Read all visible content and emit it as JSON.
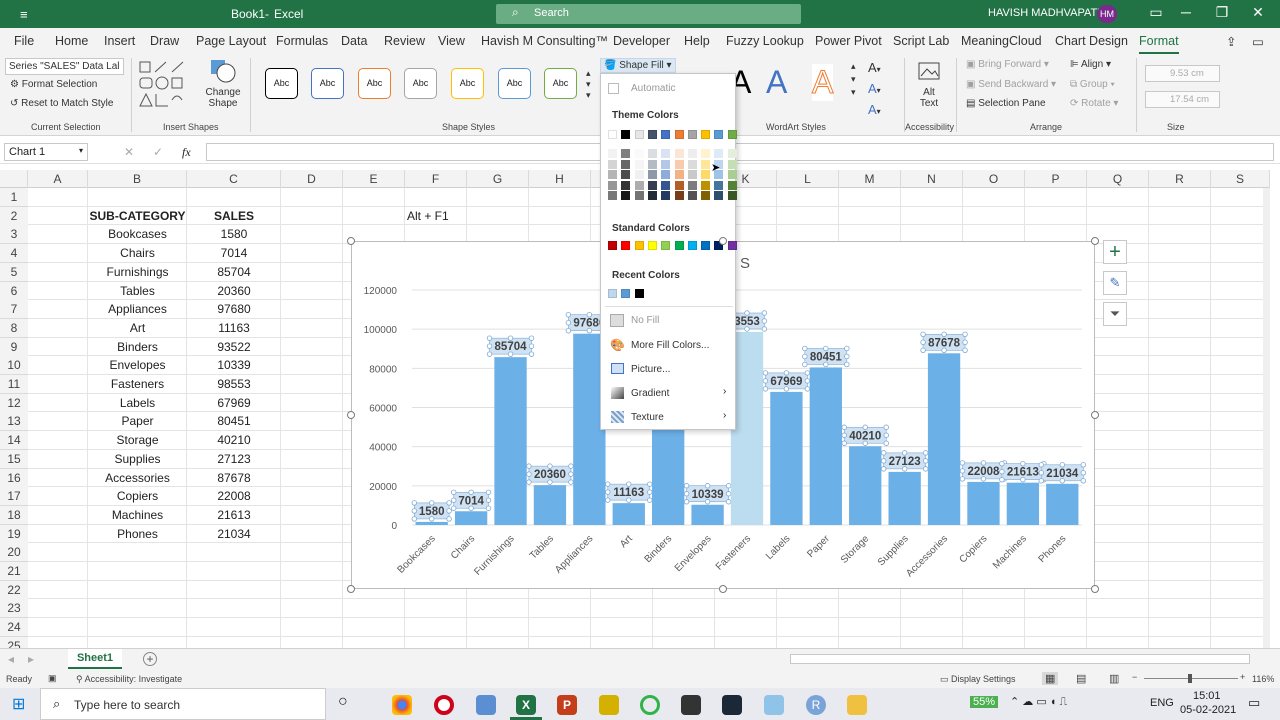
{
  "titlebar": {
    "autosave_icon": "≡",
    "filename": "Book1",
    "sep": "-",
    "app": "Excel",
    "search_placeholder": "Search",
    "user": "HAVISH MADHVAPATY",
    "initials": "HM"
  },
  "tabs": [
    "File",
    "Home",
    "Insert",
    "Draw",
    "Page Layout",
    "Formulas",
    "Data",
    "Review",
    "View",
    "Havish M Consulting™",
    "Developer",
    "Help",
    "Fuzzy Lookup",
    "Power Pivot",
    "Script Lab",
    "MeaningCloud",
    "Chart Design",
    "Format"
  ],
  "ribbon": {
    "selection_dropdown": "Series \"SALES\" Data Lal",
    "format_selection": "Format Selection",
    "reset_style": "Reset to Match Style",
    "current_selection": "Current Selection",
    "change_shape": "Change Shape",
    "insert_shapes": "Insert Shapes",
    "abc": "Abc",
    "shape_styles": "Shape Styles",
    "shape_fill": "Shape Fill",
    "wordart_styles": "WordArt Styles",
    "alt_text": "Alt Text",
    "accessibility": "Accessibility",
    "bring_forward": "Bring Forward",
    "send_backward": "Send Backward",
    "selection_pane": "Selection Pane",
    "align": "Align",
    "group": "Group",
    "rotate": "Rotate",
    "arrange": "Arrange",
    "height": "9.53 cm",
    "width": "17.54 cm",
    "size": "Size"
  },
  "formula_bar": {
    "name_box": "Chart 1",
    "fx": "fx",
    "cancel": "✕",
    "enter": "✓"
  },
  "columns": [
    "A",
    "B",
    "C",
    "D",
    "E",
    "F",
    "G",
    "H",
    "I",
    "J",
    "K",
    "L",
    "M",
    "N",
    "O",
    "P",
    "Q",
    "R",
    "S"
  ],
  "rows": [
    "1",
    "2",
    "3",
    "4",
    "5",
    "6",
    "7",
    "8",
    "9",
    "10",
    "11",
    "12",
    "13",
    "14",
    "15",
    "16",
    "17",
    "18",
    "19",
    "20",
    "21",
    "22",
    "23",
    "24",
    "25"
  ],
  "table": {
    "header_category": "SUB-CATEGORY",
    "header_sales": "SALES",
    "rows": [
      [
        "Bookcases",
        "1580"
      ],
      [
        "Chairs",
        "7014"
      ],
      [
        "Furnishings",
        "85704"
      ],
      [
        "Tables",
        "20360"
      ],
      [
        "Appliances",
        "97680"
      ],
      [
        "Art",
        "11163"
      ],
      [
        "Binders",
        "93522"
      ],
      [
        "Envelopes",
        "10339"
      ],
      [
        "Fasteners",
        "98553"
      ],
      [
        "Labels",
        "67969"
      ],
      [
        "Paper",
        "80451"
      ],
      [
        "Storage",
        "40210"
      ],
      [
        "Supplies",
        "27123"
      ],
      [
        "Accessories",
        "87678"
      ],
      [
        "Copiers",
        "22008"
      ],
      [
        "Machines",
        "21613"
      ],
      [
        "Phones",
        "21034"
      ]
    ]
  },
  "note": "Alt + F1",
  "chart_data": {
    "type": "bar",
    "title": "S",
    "categories": [
      "Bookcases",
      "Chairs",
      "Furnishings",
      "Tables",
      "Appliances",
      "Art",
      "Binders",
      "Envelopes",
      "Fasteners",
      "Labels",
      "Paper",
      "Storage",
      "Supplies",
      "Accessories",
      "Copiers",
      "Machines",
      "Phones"
    ],
    "values": [
      1580,
      7014,
      85704,
      20360,
      97680,
      11163,
      93522,
      10339,
      98553,
      67969,
      80451,
      40210,
      27123,
      87678,
      22008,
      21613,
      21034
    ],
    "data_labels": [
      "1580",
      "7014",
      "85704",
      "20360",
      "97680",
      "11163",
      "",
      "10339",
      "3553",
      "67969",
      "80451",
      "40210",
      "27123",
      "87678",
      "22008",
      "21613",
      "21034"
    ],
    "yticks": [
      "0",
      "20000",
      "40000",
      "60000",
      "80000",
      "100000",
      "120000"
    ],
    "ylim": [
      0,
      120000
    ],
    "bar_color": "#6cb0e8",
    "highlight_color": "#bcdcef",
    "label_bg": "#cfe2f3",
    "grid": true
  },
  "dropdown": {
    "automatic": "Automatic",
    "theme_colors": "Theme Colors",
    "theme_top": [
      "#ffffff",
      "#000000",
      "#e7e6e6",
      "#44546a",
      "#4472c4",
      "#ed7d31",
      "#a5a5a5",
      "#ffc000",
      "#5b9bd5",
      "#70ad47"
    ],
    "standard_colors": "Standard Colors",
    "standard": [
      "#c00000",
      "#ff0000",
      "#ffc000",
      "#ffff00",
      "#92d050",
      "#00b050",
      "#00b0f0",
      "#0070c0",
      "#002060",
      "#7030a0"
    ],
    "recent_colors": "Recent Colors",
    "recent": [
      "#bdd7ee",
      "#5b9bd5",
      "#000000"
    ],
    "no_fill": "No Fill",
    "more_fill": "More Fill Colors...",
    "picture": "Picture...",
    "gradient": "Gradient",
    "texture": "Texture"
  },
  "sheet": {
    "name": "Sheet1",
    "add": "+"
  },
  "status": {
    "ready": "Ready",
    "accessibility": "Accessibility: Investigate",
    "display_settings": "Display Settings",
    "zoom": "116%"
  },
  "taskbar": {
    "search": "Type here to search",
    "battery": "55%",
    "lang": "ENG",
    "time": "15:01",
    "date": "05-02-2021"
  }
}
